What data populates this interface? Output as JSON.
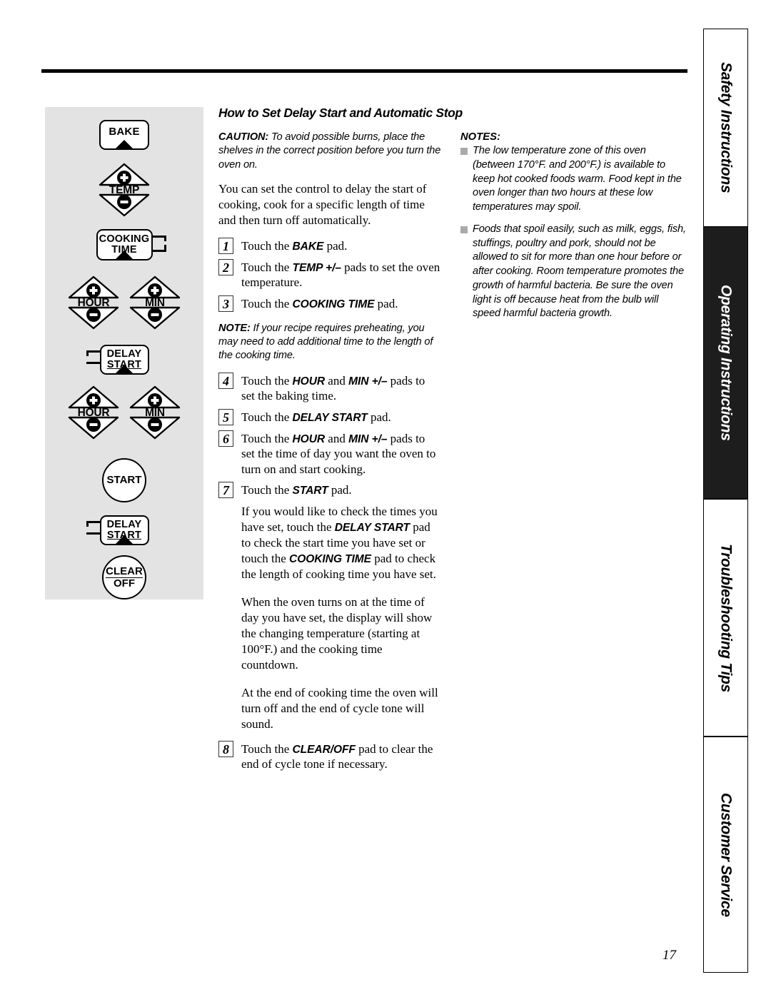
{
  "page": {
    "number": "17"
  },
  "control_panel": {
    "buttons": [
      {
        "name": "bake",
        "label": "BAKE",
        "type": "pad"
      },
      {
        "name": "temp",
        "label": "TEMP",
        "type": "plus-minus"
      },
      {
        "name": "cooking-time",
        "label_line1": "COOKING",
        "label_line2": "TIME",
        "type": "pad"
      },
      {
        "name": "hour",
        "label": "HOUR",
        "type": "plus-minus"
      },
      {
        "name": "min",
        "label": "MIN",
        "type": "plus-minus"
      },
      {
        "name": "delay-start-upper",
        "label_line1": "DELAY",
        "label_line2": "START",
        "type": "pad"
      },
      {
        "name": "hour-2",
        "label": "HOUR",
        "type": "plus-minus"
      },
      {
        "name": "min-2",
        "label": "MIN",
        "type": "plus-minus"
      },
      {
        "name": "start",
        "label": "START",
        "type": "circle"
      },
      {
        "name": "delay-start-lower",
        "label_line1": "DELAY",
        "label_line2": "START",
        "type": "pad"
      },
      {
        "name": "clear-off",
        "label_line1": "CLEAR",
        "label_line2": "OFF",
        "type": "circle"
      }
    ]
  },
  "main": {
    "title": "How to Set Delay Start and Automatic Stop",
    "caution_label": "CAUTION:",
    "caution_text": " To avoid possible burns, place the shelves in the correct position before you turn the oven on.",
    "intro": "You can set the control to delay the start of cooking, cook for a specific length of time and then turn off automatically.",
    "steps": [
      {
        "num": "1",
        "pre": "Touch the ",
        "pad": "BAKE",
        "post": " pad."
      },
      {
        "num": "2",
        "pre": "Touch the ",
        "pad": "TEMP +/–",
        "post": " pads to set the oven temperature."
      },
      {
        "num": "3",
        "pre": "Touch the ",
        "pad": "COOKING TIME",
        "post": " pad."
      }
    ],
    "note_label": "NOTE:",
    "note_text": " If your recipe requires preheating, you may need to add additional time to the length of the cooking time.",
    "steps2": [
      {
        "num": "4",
        "pre": "Touch the ",
        "pad": "HOUR",
        "mid": " and ",
        "pad2": "MIN +/–",
        "post": " pads to set the baking time."
      },
      {
        "num": "5",
        "pre": "Touch the ",
        "pad": "DELAY START",
        "post": " pad."
      },
      {
        "num": "6",
        "pre": "Touch the ",
        "pad": "HOUR",
        "mid": " and ",
        "pad2": "MIN +/–",
        "post": " pads to set the time of day you want the oven to turn on and start cooking."
      },
      {
        "num": "7",
        "pre": "Touch the ",
        "pad": "START",
        "post": " pad."
      }
    ],
    "check_para": {
      "p1": "If you would like to check the times you have set, touch the ",
      "pad1": "DELAY START",
      "p2": " pad to check the start time you have set or touch the ",
      "pad2": "COOKING TIME",
      "p3": " pad to check the length of cooking time you have set."
    },
    "display_para": "When the oven turns on at the time of day you have set, the display will show the changing temperature (starting at 100°F.) and the cooking time countdown.",
    "end_para": "At the end of cooking time the oven will turn off and the end of cycle tone will sound.",
    "step8": {
      "num": "8",
      "pre": "Touch the ",
      "pad": "CLEAR/OFF",
      "post": " pad to clear the end of cycle tone if necessary."
    }
  },
  "notes": {
    "title": "NOTES:",
    "items": [
      "The low temperature zone of this oven (between 170°F. and 200°F.) is available to keep hot cooked foods warm. Food kept in the oven longer than two hours at these low temperatures may spoil.",
      "Foods that spoil easily, such as milk, eggs, fish, stuffings, poultry and pork, should not be allowed to sit for more than one hour before or after cooking. Room temperature promotes the growth of harmful bacteria. Be sure the oven light is off because heat from the bulb will speed harmful bacteria growth."
    ]
  },
  "tabs": [
    {
      "label": "Safety Instructions",
      "active": false
    },
    {
      "label": "Operating Instructions",
      "active": true
    },
    {
      "label": "Troubleshooting Tips",
      "active": false
    },
    {
      "label": "Customer Service",
      "active": false
    }
  ]
}
